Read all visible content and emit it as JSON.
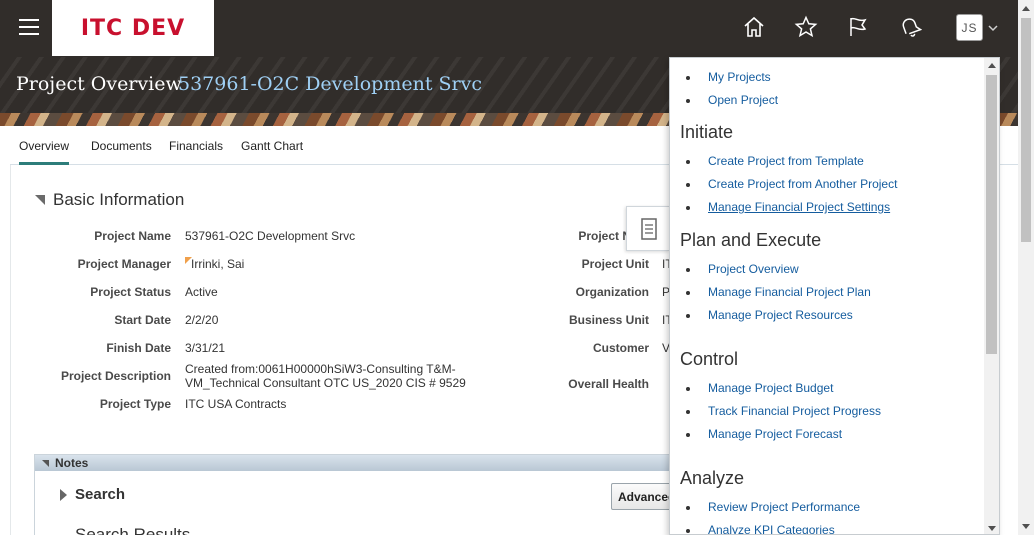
{
  "header": {
    "logo": "ITC DEV",
    "user_initials": "JS",
    "icons": [
      "hamburger-icon",
      "home-icon",
      "star-icon",
      "flag-icon",
      "bell-icon",
      "chevron-down-icon"
    ]
  },
  "page": {
    "title": "Project Overview",
    "subtitle": "537961-O2C Development Srvc"
  },
  "tabs": [
    {
      "label": "Overview",
      "active": true
    },
    {
      "label": "Documents",
      "active": false
    },
    {
      "label": "Financials",
      "active": false
    },
    {
      "label": "Gantt Chart",
      "active": false
    }
  ],
  "basic_info": {
    "title": "Basic Information",
    "left": [
      {
        "label": "Project Name",
        "value": "537961-O2C Development Srvc"
      },
      {
        "label": "Project Manager",
        "value": "Irrinki, Sai"
      },
      {
        "label": "Project Status",
        "value": "Active"
      },
      {
        "label": "Start Date",
        "value": "2/2/20"
      },
      {
        "label": "Finish Date",
        "value": "3/31/21"
      },
      {
        "label": "Project Description",
        "value_line1": "Created from:0061H00000hSiW3-Consulting T&M-",
        "value_line2": "VM_Technical Consultant OTC US_2020 CIS # 9529"
      },
      {
        "label": "Project Type",
        "value": "ITC USA Contracts"
      }
    ],
    "right": [
      {
        "label": "Project Num",
        "value": ""
      },
      {
        "label": "Project Unit",
        "value": "IT"
      },
      {
        "label": "Organization",
        "value": "P"
      },
      {
        "label": "Business Unit",
        "value": "IT"
      },
      {
        "label": "Customer",
        "value": "V"
      },
      {
        "label": "Overall Health",
        "value": ""
      }
    ]
  },
  "notes": {
    "title": "Notes",
    "search_title": "Search",
    "advanced_label": "Advanced",
    "results_title": "Search Results"
  },
  "task_panel": {
    "top_links": [
      "My Projects",
      "Open Project"
    ],
    "groups": [
      {
        "heading": "Initiate",
        "links": [
          "Create Project from Template",
          "Create Project from Another Project",
          "Manage Financial Project Settings"
        ]
      },
      {
        "heading": "Plan and Execute",
        "links": [
          "Project Overview",
          "Manage Financial Project Plan",
          "Manage Project Resources"
        ]
      },
      {
        "heading": "Control",
        "links": [
          "Manage Project Budget",
          "Track Financial Project Progress",
          "Manage Project Forecast"
        ]
      },
      {
        "heading": "Analyze",
        "links": [
          "Review Project Performance",
          "Analyze KPI Categories"
        ]
      }
    ]
  },
  "colors": {
    "header_bg": "#312d2a",
    "logo_red": "#c8102e",
    "link_blue": "#145c9e",
    "subtitle_blue": "#9fd0f5",
    "tab_accent": "#2d7d7a"
  }
}
